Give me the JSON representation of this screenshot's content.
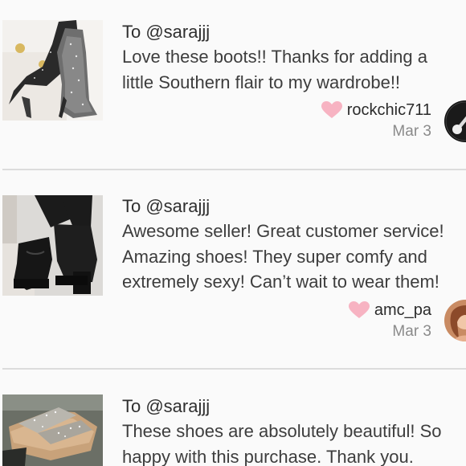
{
  "reviews": [
    {
      "to": "To @sarajjj",
      "text": "Love these boots!! Thanks for adding a\nlittle Southern flair to my wardrobe!!",
      "username": "rockchic711",
      "date": "Mar 3",
      "thumb_icon": "rhinestone-knee-boots-photo",
      "avatar_icon": "guitar-avatar",
      "heart_color": "#f7b3c2"
    },
    {
      "to": "To @sarajjj",
      "text": "Awesome seller! Great customer service!\nAmazing shoes! They super comfy and\nextremely sexy! Can’t wait to wear them!",
      "username": "amc_pa",
      "date": "Mar 3",
      "thumb_icon": "black-platform-heels-photo",
      "avatar_icon": "user-photo-avatar",
      "heart_color": "#f7b3c2"
    },
    {
      "to": "To @sarajjj",
      "text": "These shoes are absolutely beautiful! So\nhappy with this purchase. Thank you.",
      "thumb_icon": "glitter-sandals-photo"
    }
  ]
}
